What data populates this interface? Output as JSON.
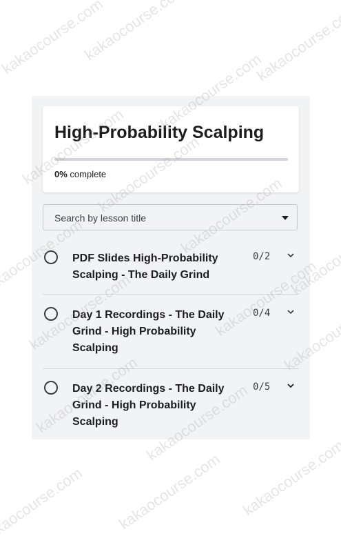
{
  "course": {
    "title": "High-Probability Scalping",
    "progress_percent_label": "0%",
    "progress_suffix": " complete",
    "progress_fraction": 0
  },
  "search": {
    "placeholder": "Search by lesson title"
  },
  "sections": [
    {
      "title": "PDF Slides High-Probability Scalping - The Daily Grind",
      "count": "0/2"
    },
    {
      "title": "Day 1 Recordings - The Daily Grind - High Probability Scalping",
      "count": "0/4"
    },
    {
      "title": "Day 2 Recordings - The Daily Grind - High Probability Scalping",
      "count": "0/5"
    }
  ],
  "watermark": {
    "text": "kakaocourse.com"
  },
  "icons": {
    "section_status": "empty-circle-icon",
    "section_toggle": "chevron-down-icon",
    "select_caret": "caret-down-icon"
  },
  "colors": {
    "panel_bg": "#f2f3f5",
    "text_primary": "#1c1d1f",
    "track": "#d1d3d8"
  }
}
